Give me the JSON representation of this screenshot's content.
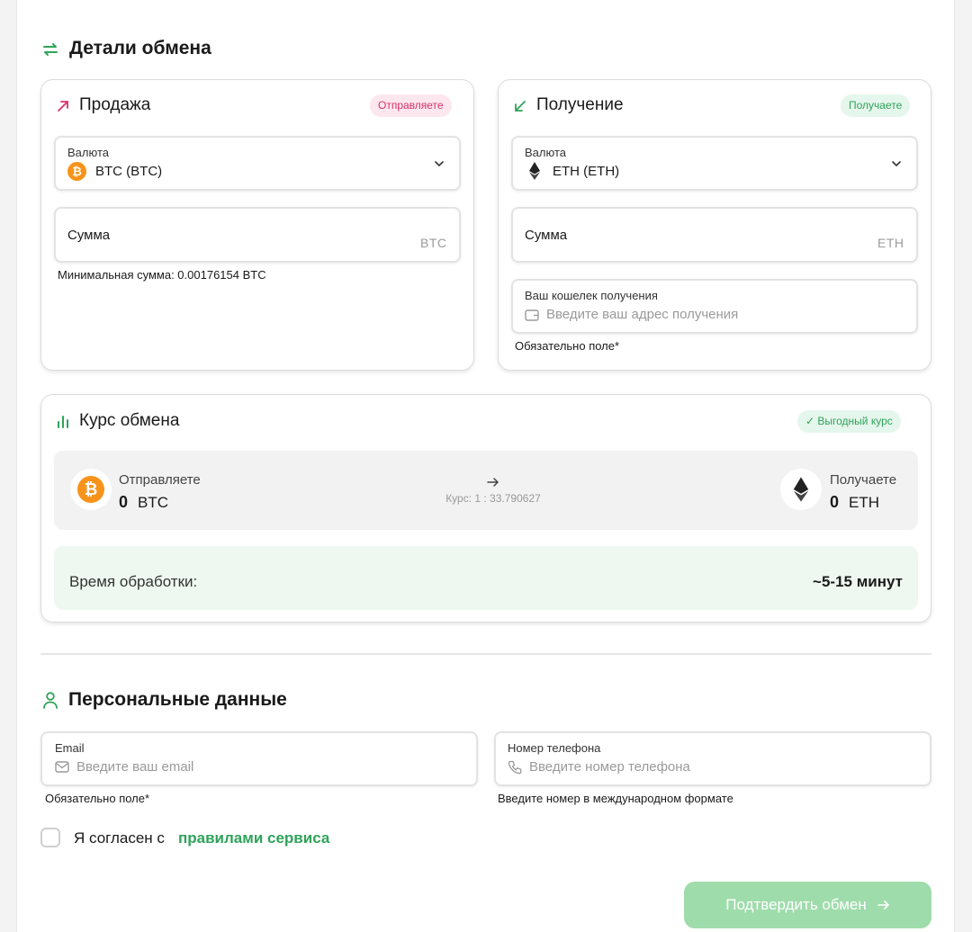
{
  "exchange": {
    "title": "Детали обмена",
    "sell": {
      "title": "Продажа",
      "badge": "Отправляете",
      "currency_label": "Валюта",
      "currency_value": "BTC (BTC)",
      "amount_label": "Сумма",
      "amount_unit": "BTC",
      "min_hint": "Минимальная сумма: 0.00176154 BTC"
    },
    "receive": {
      "title": "Получение",
      "badge": "Получаете",
      "currency_label": "Валюта",
      "currency_value": "ETH (ETH)",
      "amount_label": "Сумма",
      "amount_unit": "ETH",
      "wallet_label": "Ваш кошелек получения",
      "wallet_placeholder": "Введите ваш адрес получения",
      "required_hint": "Обязательно поле*"
    }
  },
  "rate": {
    "title": "Курс обмена",
    "badge": "✓ Выгодный курс",
    "send_label": "Отправляете",
    "send_amount": "0",
    "send_unit": "BTC",
    "rate_text": "Курс: 1 : 33.790627",
    "receive_label": "Получаете",
    "receive_amount": "0",
    "receive_unit": "ETH",
    "processing_label": "Время обработки:",
    "processing_value": "~5-15 минут"
  },
  "personal": {
    "title": "Персональные данные",
    "email_label": "Email",
    "email_placeholder": "Введите ваш email",
    "email_hint": "Обязательно поле*",
    "phone_label": "Номер телефона",
    "phone_placeholder": "Введите номер телефона",
    "phone_hint": "Введите номер в международном формате",
    "agree_text": "Я согласен с",
    "agree_link": "правилами сервиса"
  },
  "submit_label": "Подтвердить обмен",
  "colors": {
    "accent_green": "#2fa35a",
    "accent_red": "#d9316a",
    "btc_orange": "#f7931a",
    "submit_bg": "#9fdcab"
  }
}
